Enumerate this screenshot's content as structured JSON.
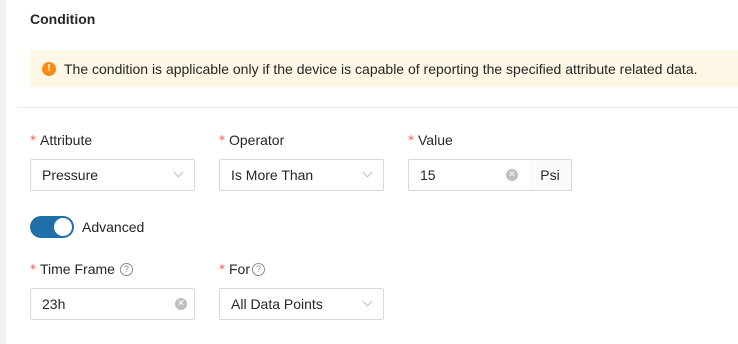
{
  "section": {
    "title": "Condition"
  },
  "alert": {
    "icon": "exclamation-icon",
    "color": "#fa8c16",
    "text": "The condition is applicable only if the device is capable of reporting the specified attribute related data."
  },
  "fields": {
    "attribute": {
      "label": "Attribute",
      "required": "*",
      "value": "Pressure"
    },
    "operator": {
      "label": "Operator",
      "required": "*",
      "value": "Is More Than"
    },
    "value": {
      "label": "Value",
      "required": "*",
      "value": "15",
      "unit": "Psi"
    },
    "time_frame": {
      "label": "Time Frame",
      "required": "*",
      "value": "23h"
    },
    "for": {
      "label": "For",
      "required": "*",
      "value": "All Data Points"
    }
  },
  "advanced": {
    "label": "Advanced",
    "enabled": true,
    "color": "#1f6fa8"
  },
  "help_glyph": "?"
}
